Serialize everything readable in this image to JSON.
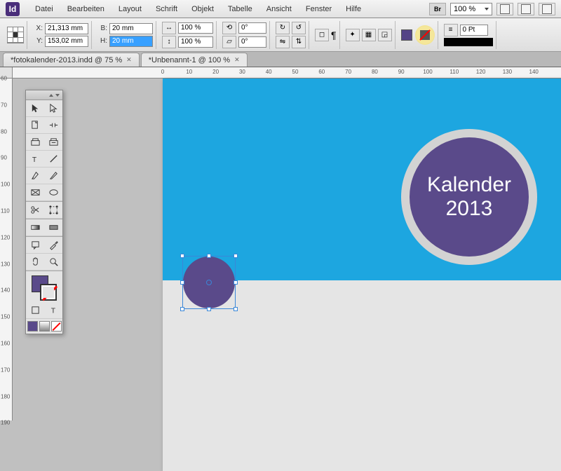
{
  "app": {
    "icon_label": "Id"
  },
  "menu": {
    "items": [
      "Datei",
      "Bearbeiten",
      "Layout",
      "Schrift",
      "Objekt",
      "Tabelle",
      "Ansicht",
      "Fenster",
      "Hilfe"
    ],
    "br": "Br",
    "zoom": "100 %"
  },
  "control": {
    "x_label": "X:",
    "x": "21,313 mm",
    "y_label": "Y:",
    "y": "153,02 mm",
    "w_label": "B:",
    "w": "20 mm",
    "h_label": "H:",
    "h": "20 mm",
    "scale_x": "100 %",
    "scale_y": "100 %",
    "rotate": "0°",
    "shear": "0°",
    "stroke_weight": "0 Pt"
  },
  "tabs": [
    {
      "label": "*fotokalender-2013.indd @ 75 %",
      "active": false
    },
    {
      "label": "*Unbenannt-1 @ 100 %",
      "active": true
    }
  ],
  "ruler_h": [
    0,
    10,
    20,
    30,
    40,
    50,
    60,
    70,
    80,
    90,
    100,
    110,
    120,
    130,
    140
  ],
  "ruler_v": [
    60,
    70,
    80,
    90,
    100,
    110,
    120,
    130,
    140,
    150,
    160,
    170,
    180,
    190
  ],
  "artwork": {
    "title_line1": "Kalender",
    "title_line2": "2013"
  },
  "colors": {
    "accent_purple": "#5a4a8a",
    "canvas_blue": "#1da6e0"
  }
}
